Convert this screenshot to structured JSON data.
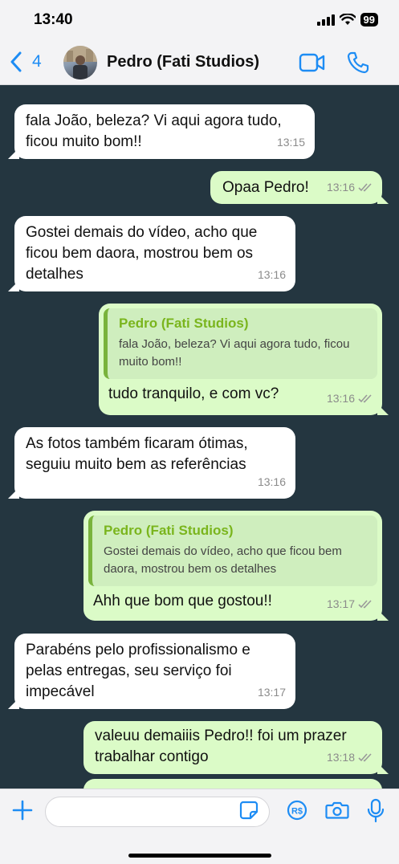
{
  "status": {
    "time": "13:40",
    "battery": "99"
  },
  "header": {
    "back_count": "4",
    "contact_name": "Pedro (Fati Studios)"
  },
  "messages": [
    {
      "dir": "in",
      "text": "fala João, beleza? Vi aqui agora tudo,\nficou muito bom!!",
      "time": "13:15"
    },
    {
      "dir": "out",
      "text": "Opaa Pedro!",
      "time": "13:16"
    },
    {
      "dir": "in",
      "text": "Gostei demais do vídeo, acho que\nficou bem daora, mostrou bem os\ndetalhes",
      "time": "13:16"
    },
    {
      "dir": "out",
      "quote_name": "Pedro (Fati Studios)",
      "quote_text": "fala João, beleza? Vi aqui agora tudo, ficou\nmuito bom!!",
      "text": "tudo tranquilo, e com vc?",
      "time": "13:16"
    },
    {
      "dir": "in",
      "text": "As fotos também ficaram ótimas,\nseguiu muito bem as referências",
      "time": "13:16"
    },
    {
      "dir": "out",
      "quote_name": "Pedro (Fati Studios)",
      "quote_text": "Gostei demais do vídeo, acho que ficou bem\ndaora, mostrou bem os detalhes",
      "text": "Ahh que bom que gostou!!",
      "time": "13:17"
    },
    {
      "dir": "in",
      "text": "Parabéns pelo profissionalismo e\npelas entregas, seu serviço foi\nimpecável",
      "time": "13:17"
    },
    {
      "dir": "out",
      "text": "valeuu demaiiis Pedro!! foi um prazer\ntrabalhar contigo",
      "time": "13:18"
    }
  ],
  "icons": {
    "back": "chevron-left-icon",
    "video": "video-camera-icon",
    "call": "phone-icon",
    "plus": "plus-icon",
    "sticker": "sticker-icon",
    "payment": "payment-icon",
    "camera": "camera-icon",
    "mic": "microphone-icon",
    "read": "double-check-icon"
  },
  "colors": {
    "accent": "#1d8cf4",
    "chat_bg": "#243640",
    "out_bubble": "#dbfbc7",
    "quote_name": "#7ab51d"
  }
}
